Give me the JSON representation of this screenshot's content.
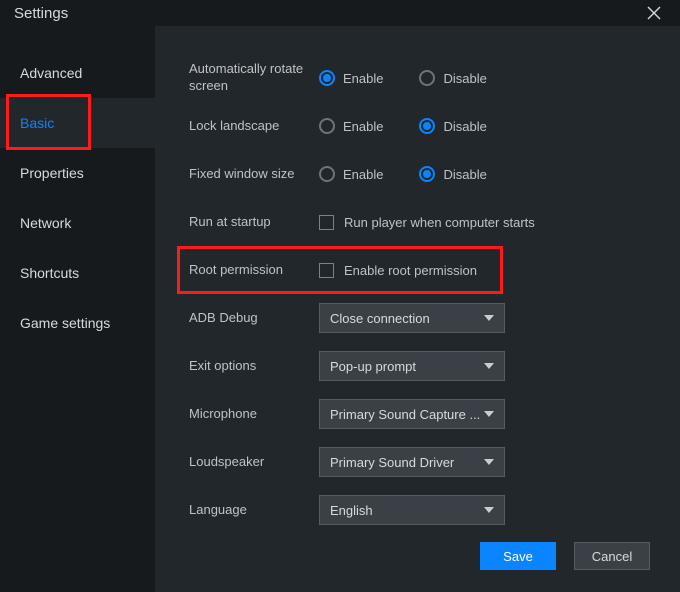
{
  "window": {
    "title": "Settings"
  },
  "sidebar": {
    "items": [
      {
        "label": "Advanced"
      },
      {
        "label": "Basic"
      },
      {
        "label": "Properties"
      },
      {
        "label": "Network"
      },
      {
        "label": "Shortcuts"
      },
      {
        "label": "Game settings"
      }
    ]
  },
  "settings": {
    "rotate": {
      "label": "Automatically rotate screen",
      "enable": "Enable",
      "disable": "Disable",
      "value": "enable"
    },
    "lock": {
      "label": "Lock landscape",
      "enable": "Enable",
      "disable": "Disable",
      "value": "disable"
    },
    "fixed": {
      "label": "Fixed window size",
      "enable": "Enable",
      "disable": "Disable",
      "value": "disable"
    },
    "startup": {
      "label": "Run at startup",
      "check_label": "Run player when computer starts",
      "checked": false
    },
    "root": {
      "label": "Root permission",
      "check_label": "Enable root permission",
      "checked": false
    },
    "adb": {
      "label": "ADB Debug",
      "value": "Close connection"
    },
    "exit": {
      "label": "Exit options",
      "value": "Pop-up prompt"
    },
    "mic": {
      "label": "Microphone",
      "value": "Primary Sound Capture ..."
    },
    "spk": {
      "label": "Loudspeaker",
      "value": "Primary Sound Driver"
    },
    "lang": {
      "label": "Language",
      "value": "English"
    }
  },
  "buttons": {
    "save": "Save",
    "cancel": "Cancel"
  },
  "colors": {
    "accent": "#0a84ff",
    "highlight": "#ff1b1b",
    "panel": "#22272b",
    "bg": "#161a1d"
  }
}
